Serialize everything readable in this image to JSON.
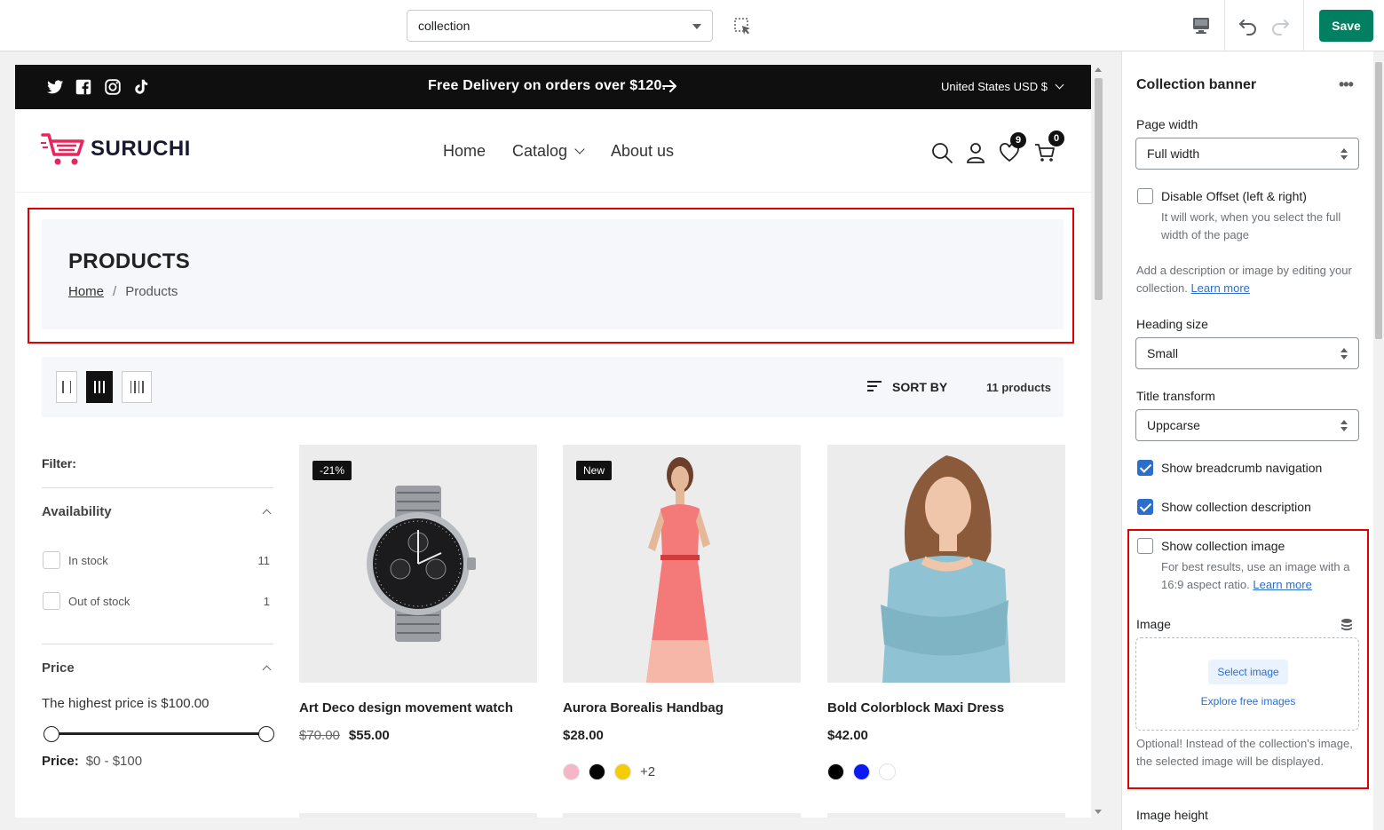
{
  "editor": {
    "template_select": "collection",
    "save_label": "Save"
  },
  "announcement": {
    "text": "Free Delivery on orders over $120.",
    "currency": "United States USD $"
  },
  "store": {
    "logo_text": "SURUCHI",
    "nav": [
      "Home",
      "Catalog",
      "About us"
    ],
    "wishlist_count": "9",
    "cart_count": "0"
  },
  "banner": {
    "title": "PRODUCTS",
    "breadcrumb_home": "Home",
    "breadcrumb_sep": "/",
    "breadcrumb_current": "Products"
  },
  "toolbar": {
    "sort_label": "SORT BY",
    "product_count": "11 products"
  },
  "filter": {
    "title": "Filter:",
    "availability_title": "Availability",
    "in_stock_label": "In stock",
    "in_stock_count": "11",
    "out_of_stock_label": "Out of stock",
    "out_of_stock_count": "1",
    "price_title": "Price",
    "price_note": "The highest price is $100.00",
    "price_range_label": "Price:",
    "price_range_value": "$0 - $100"
  },
  "products": [
    {
      "title": "Art Deco design movement watch",
      "badge": "-21%",
      "compare_price": "$70.00",
      "price": "$55.00"
    },
    {
      "title": "Aurora Borealis Handbag",
      "badge": "New",
      "price": "$28.00",
      "swatches": [
        "#f7b6c8",
        "#000000",
        "#f5cc00"
      ],
      "more_swatches": "+2"
    },
    {
      "title": "Bold Colorblock Maxi Dress",
      "price": "$42.00",
      "swatches": [
        "#000000",
        "#0a1af0",
        "#ffffff"
      ]
    }
  ],
  "panel": {
    "title": "Collection banner",
    "page_width_label": "Page width",
    "page_width_value": "Full width",
    "disable_offset_label": "Disable Offset (left & right)",
    "disable_offset_help": "It will work, when you select the full width of the page",
    "description_help": "Add a description or image by editing your collection.",
    "learn_more": "Learn more",
    "heading_size_label": "Heading size",
    "heading_size_value": "Small",
    "title_transform_label": "Title transform",
    "title_transform_value": "Uppcarse",
    "show_breadcrumb_label": "Show breadcrumb navigation",
    "show_description_label": "Show collection description",
    "show_image_label": "Show collection image",
    "show_image_help": "For best results, use an image with a 16:9 aspect ratio.",
    "image_label": "Image",
    "select_image": "Select image",
    "explore_images": "Explore free images",
    "image_optional_help": "Optional! Instead of the collection's image, the selected image will be displayed.",
    "image_height_label": "Image height"
  },
  "colors": {
    "accent": "#008060",
    "link": "#2c6ecb",
    "highlight_frame": "#e00000",
    "logo_pink": "#e8255d"
  }
}
